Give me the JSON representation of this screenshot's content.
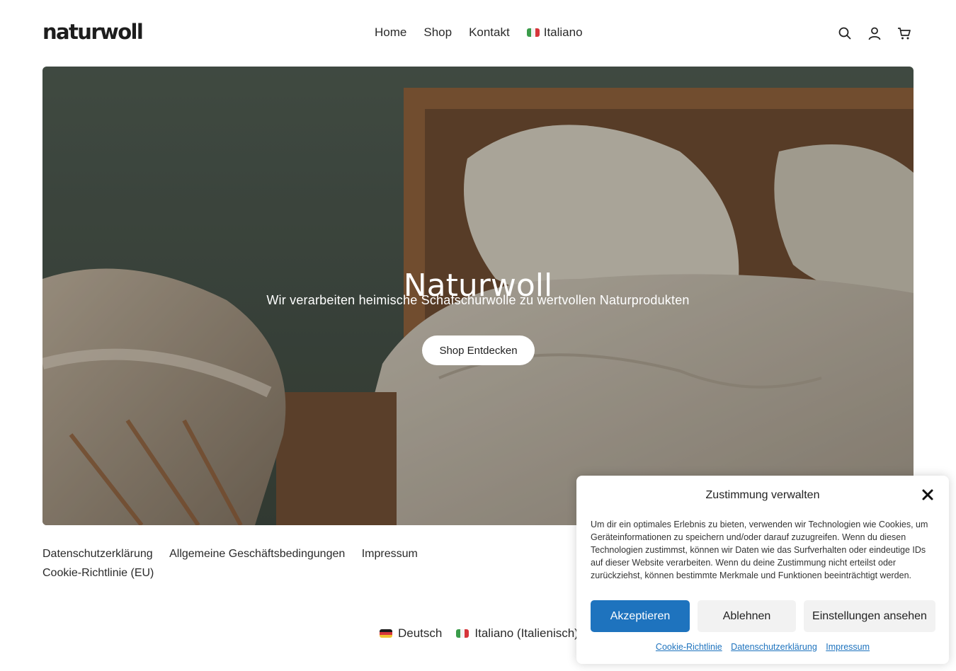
{
  "header": {
    "logo": "naturwoll",
    "nav": [
      {
        "label": "Home"
      },
      {
        "label": "Shop"
      },
      {
        "label": "Kontakt"
      },
      {
        "label": "Italiano"
      }
    ],
    "icons": [
      "search-icon",
      "account-icon",
      "cart-icon"
    ]
  },
  "hero": {
    "title": "Naturwoll",
    "subtitle": "Wir verarbeiten heimische Schafschurwolle zu wertvollen Naturprodukten",
    "button": "Shop Entdecken"
  },
  "footer": {
    "links": [
      "Datenschutzerklärung",
      "Allgemeine Geschäftsbedingungen",
      "Impressum",
      "Cookie-Richtlinie (EU)"
    ],
    "languages": [
      "Deutsch",
      "Italiano (Italienisch)"
    ]
  },
  "cookie_banner": {
    "title": "Zustimmung verwalten",
    "text": "Um dir ein optimales Erlebnis zu bieten, verwenden wir Technologien wie Cookies, um Geräteinformationen zu speichern und/oder darauf zuzugreifen. Wenn du diesen Technologien zustimmst, können wir Daten wie das Surfverhalten oder eindeutige IDs auf dieser Website verarbeiten. Wenn du deine Zustimmung nicht erteilst oder zurückziehst, können bestimmte Merkmale und Funktionen beeinträchtigt werden.",
    "accept": "Akzeptieren",
    "deny": "Ablehnen",
    "preferences": "Einstellungen ansehen",
    "links": [
      "Cookie-Richtlinie",
      "Datenschutzerklärung",
      "Impressum"
    ]
  },
  "colors": {
    "accent": "#1e73be",
    "text": "#1f1f1f",
    "background": "#ffffff"
  }
}
